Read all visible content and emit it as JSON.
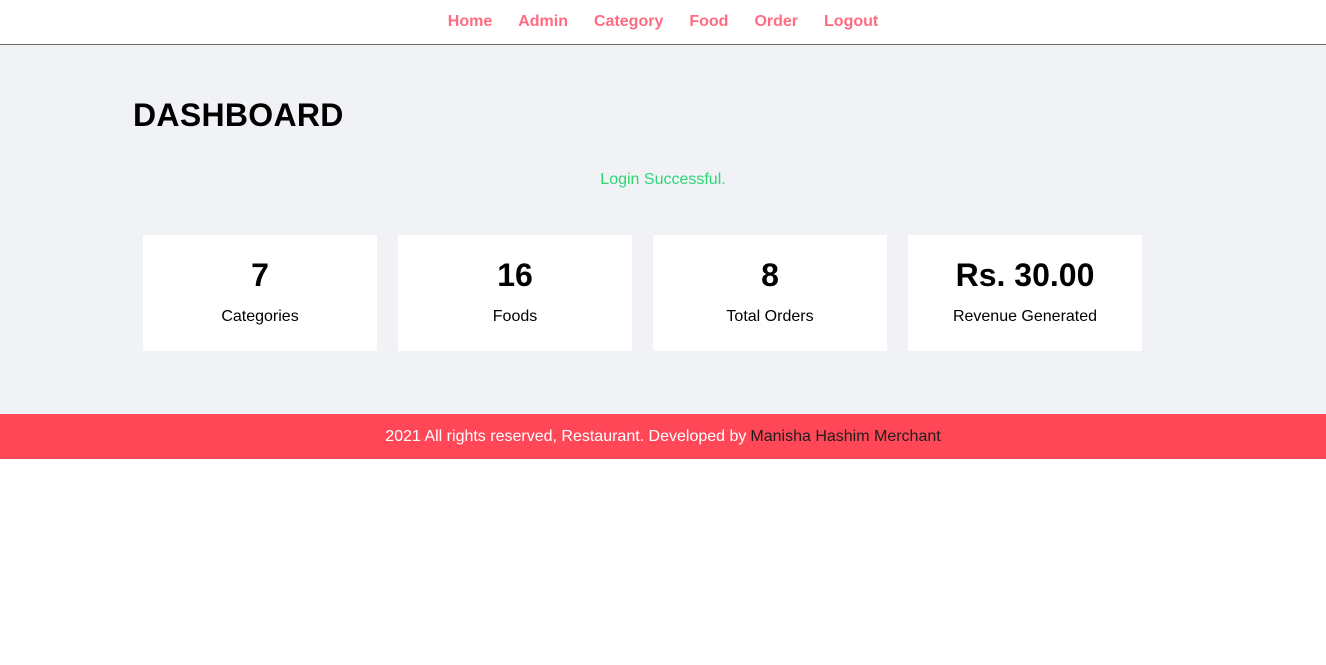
{
  "nav": {
    "items": [
      {
        "label": "Home"
      },
      {
        "label": "Admin"
      },
      {
        "label": "Category"
      },
      {
        "label": "Food"
      },
      {
        "label": "Order"
      },
      {
        "label": "Logout"
      }
    ]
  },
  "main": {
    "title": "DASHBOARD",
    "message": "Login Successful.",
    "cards": [
      {
        "value": "7",
        "label": "Categories"
      },
      {
        "value": "16",
        "label": "Foods"
      },
      {
        "value": "8",
        "label": "Total Orders"
      },
      {
        "value": "Rs. 30.00",
        "label": "Revenue Generated"
      }
    ]
  },
  "footer": {
    "text": "2021 All rights reserved, Restaurant. Developed by",
    "author": "Manisha Hashim Merchant"
  },
  "colors": {
    "nav_link": "#ff6b81",
    "background": "#f1f2f6",
    "success": "#2ed573",
    "footer_bg": "#ff4757"
  }
}
